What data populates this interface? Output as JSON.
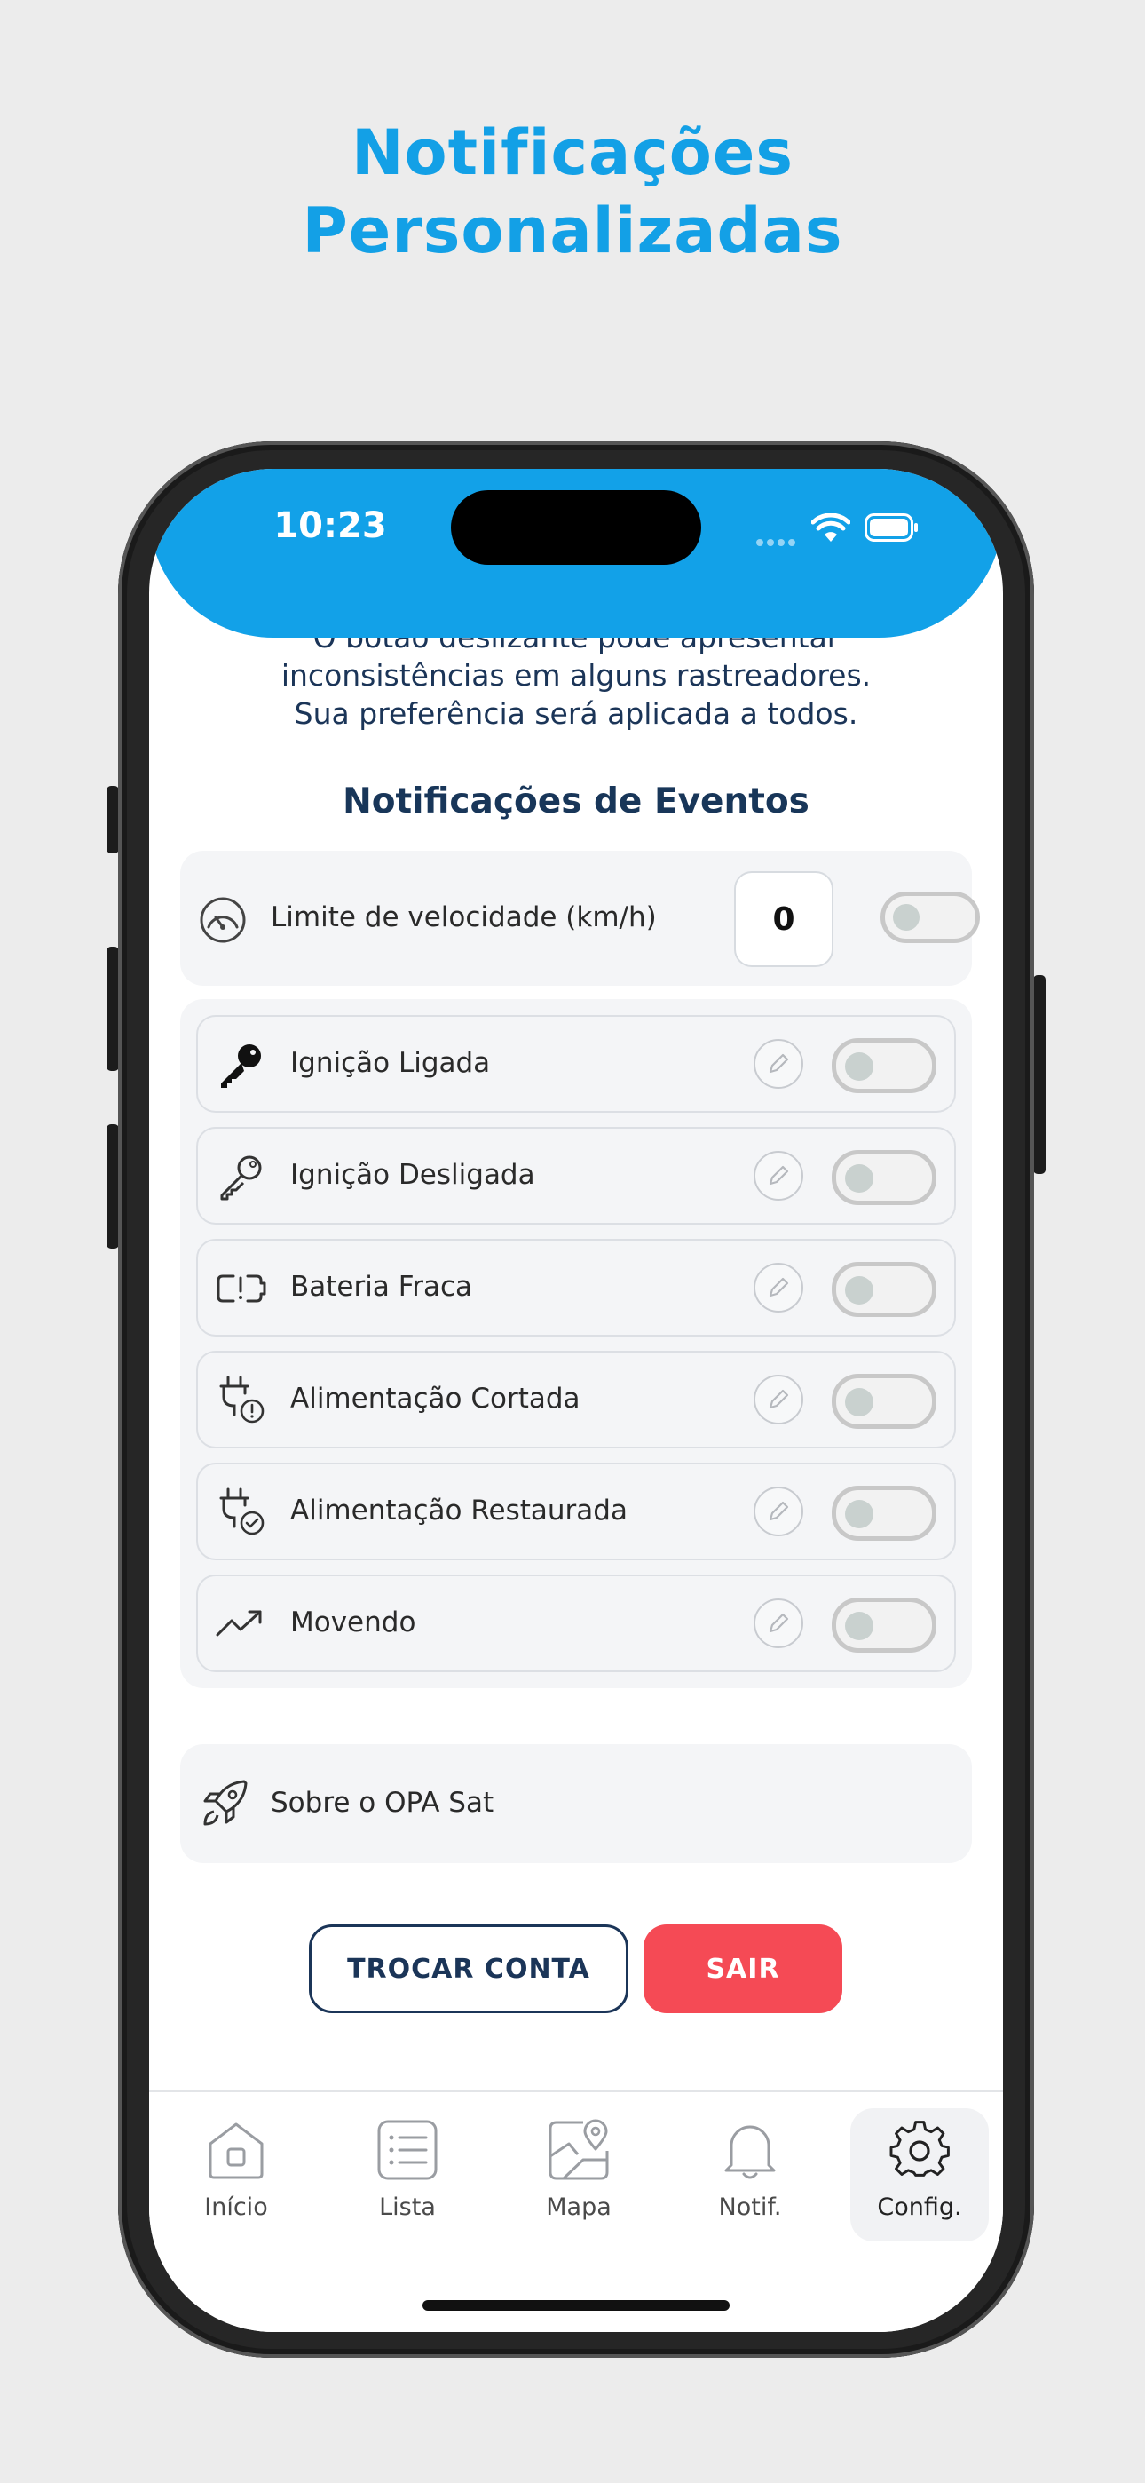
{
  "promo": {
    "title_line1": "Notificações",
    "title_line2": "Personalizadas"
  },
  "status_bar": {
    "time": "10:23"
  },
  "notice": {
    "line1": "O botão deslizante pode apresentar",
    "line2": "inconsistências em alguns rastreadores.",
    "line3": "Sua preferência será aplicada a todos."
  },
  "events_section": {
    "title": "Notificações de Eventos",
    "speed_limit": {
      "label": "Limite de velocidade (km/h)",
      "value": "0",
      "enabled": false,
      "icon": "speedometer-icon"
    },
    "events": [
      {
        "label": "Ignição Ligada",
        "icon": "key-filled-icon",
        "enabled": false
      },
      {
        "label": "Ignição Desligada",
        "icon": "key-outline-icon",
        "enabled": false
      },
      {
        "label": "Bateria Fraca",
        "icon": "battery-alert-icon",
        "enabled": false
      },
      {
        "label": "Alimentação Cortada",
        "icon": "plug-alert-icon",
        "enabled": false
      },
      {
        "label": "Alimentação Restaurada",
        "icon": "plug-check-icon",
        "enabled": false
      },
      {
        "label": "Movendo",
        "icon": "trending-up-icon",
        "enabled": false
      }
    ]
  },
  "about": {
    "label": "Sobre o OPA Sat",
    "icon": "rocket-icon"
  },
  "actions": {
    "switch_account": "TROCAR CONTA",
    "logout": "SAIR"
  },
  "tabbar": {
    "items": [
      {
        "label": "Início",
        "icon": "home-icon",
        "active": false
      },
      {
        "label": "Lista",
        "icon": "list-icon",
        "active": false
      },
      {
        "label": "Mapa",
        "icon": "map-icon",
        "active": false
      },
      {
        "label": "Notif.",
        "icon": "bell-icon",
        "active": false
      },
      {
        "label": "Config.",
        "icon": "gear-icon",
        "active": true
      }
    ]
  },
  "colors": {
    "brand_blue": "#12a1e8",
    "navy": "#1b3558",
    "danger": "#f54a55"
  }
}
